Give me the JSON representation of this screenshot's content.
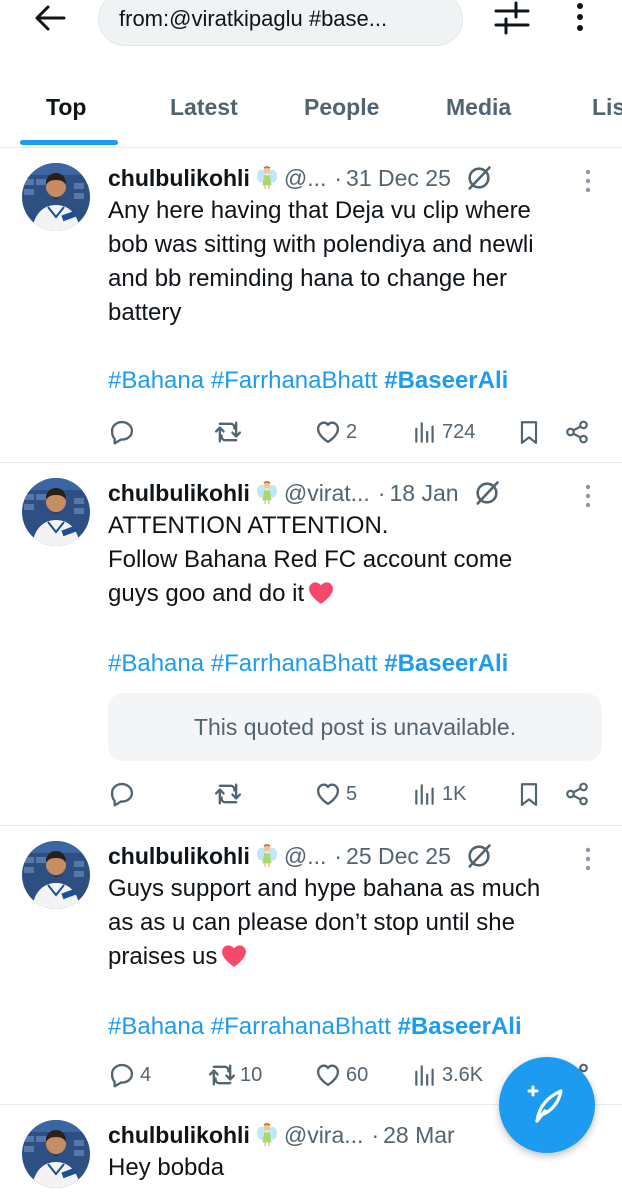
{
  "header": {
    "search_query": "from:@viratkipaglu #base..."
  },
  "tabs": [
    {
      "label": "Top",
      "active": true
    },
    {
      "label": "Latest",
      "active": false
    },
    {
      "label": "People",
      "active": false
    },
    {
      "label": "Media",
      "active": false
    },
    {
      "label": "Lis",
      "active": false
    }
  ],
  "colors": {
    "accent": "#1d9bf0",
    "secondary_text": "#536471",
    "heart_emoji": "#f7476b"
  },
  "tweets": [
    {
      "display_name": "chulbulikohli",
      "handle": "@...",
      "date": "31 Dec 25",
      "text_lines": [
        "Any here having that Deja vu clip where",
        "bob was sitting with polendiya and newli",
        "and bb reminding hana to change her",
        "battery"
      ],
      "hashtags": [
        "#Bahana",
        "#FarrhanaBhatt",
        "#BaseerAli"
      ],
      "replies": "",
      "reposts": "",
      "likes": "2",
      "views": "724"
    },
    {
      "display_name": "chulbulikohli",
      "handle": "@virat...",
      "date": "18 Jan",
      "text_lines": [
        "ATTENTION ATTENTION.",
        "Follow Bahana Red FC account come",
        "guys goo and do it"
      ],
      "hashtags": [
        "#Bahana",
        "#FarrhanaBhatt",
        "#BaseerAli"
      ],
      "quoted": "This quoted post is unavailable.",
      "replies": "",
      "reposts": "",
      "likes": "5",
      "views": "1K"
    },
    {
      "display_name": "chulbulikohli",
      "handle": "@...",
      "date": "25 Dec 25",
      "text_lines": [
        "Guys support and hype bahana as much",
        "as as u can please don’t stop until she",
        "praises us"
      ],
      "hashtags": [
        "#Bahana",
        "#FarrahanaBhatt",
        "#BaseerAli"
      ],
      "replies": "4",
      "reposts": "10",
      "likes": "60",
      "views": "3.6K"
    },
    {
      "display_name": "chulbulikohli",
      "handle": "@vira...",
      "date": "28 Mar",
      "text_lines": [
        "Hey bobda"
      ]
    }
  ],
  "fab": {
    "icon": "compose-post-icon"
  }
}
